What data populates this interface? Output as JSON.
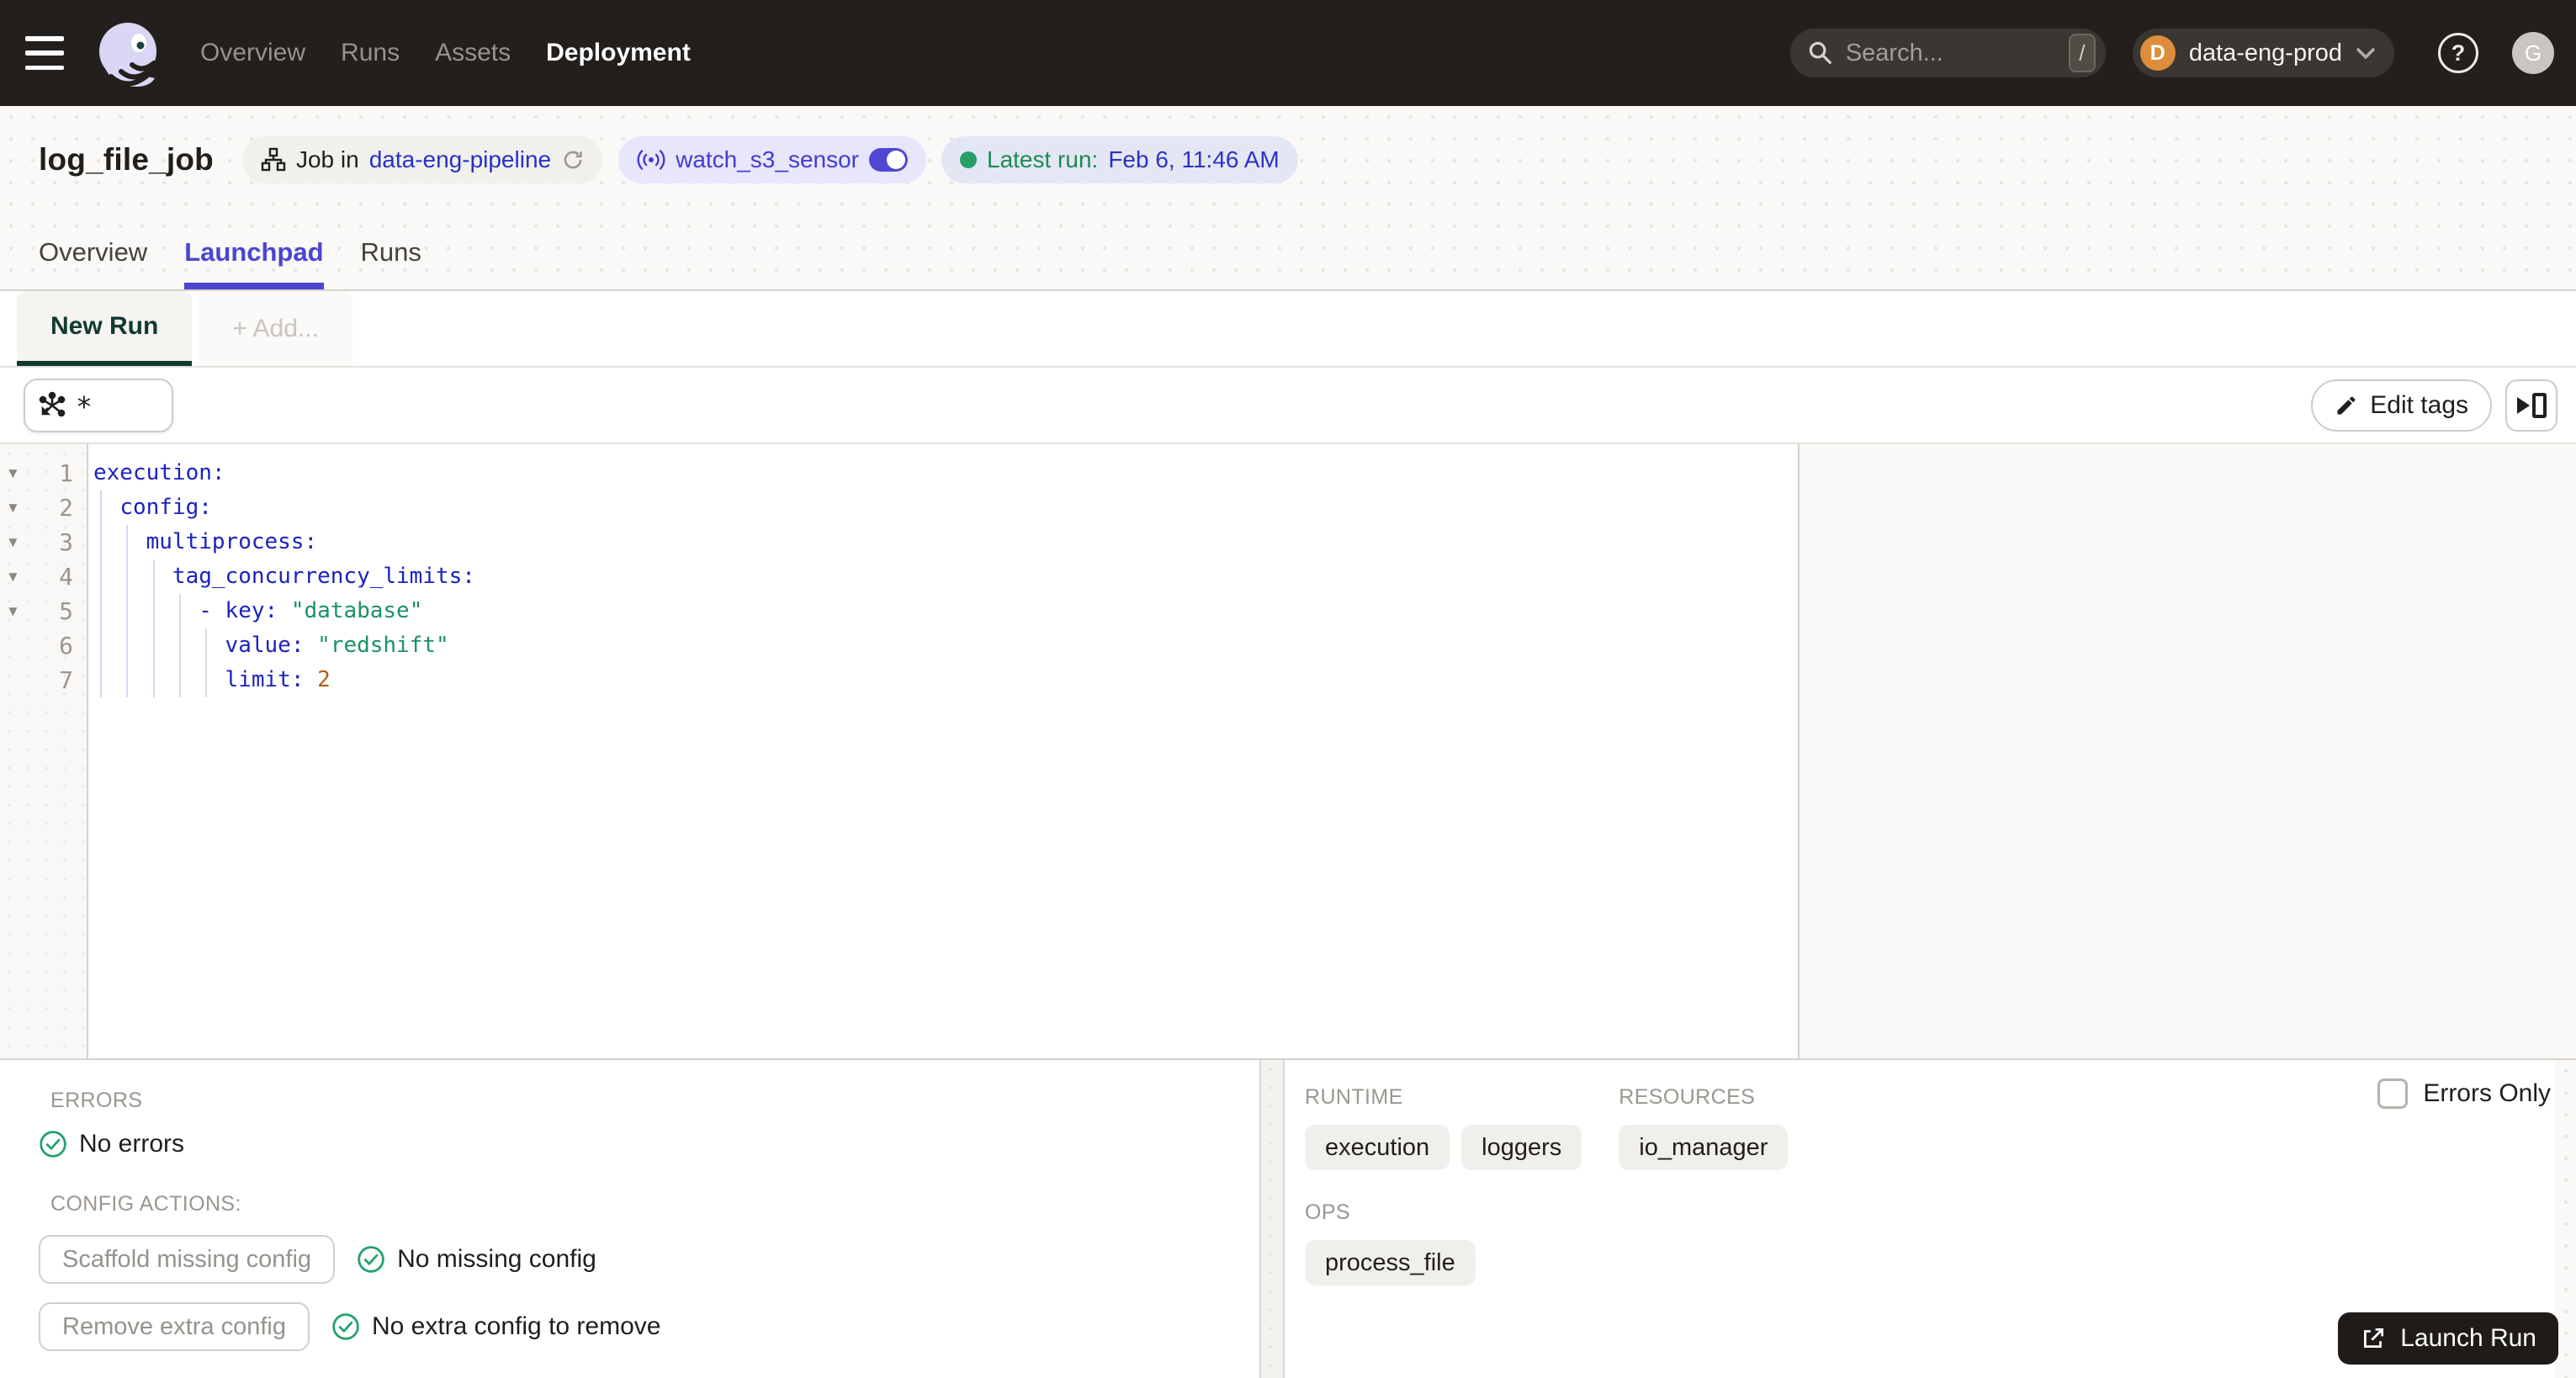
{
  "nav": {
    "items": [
      {
        "label": "Overview",
        "active": false
      },
      {
        "label": "Runs",
        "active": false
      },
      {
        "label": "Assets",
        "active": false
      },
      {
        "label": "Deployment",
        "active": true
      }
    ],
    "search_placeholder": "Search...",
    "search_shortcut": "/",
    "env": {
      "initial": "D",
      "name": "data-eng-prod"
    },
    "user_initial": "G"
  },
  "header": {
    "title": "log_file_job",
    "job_pill": {
      "prefix": "Job in",
      "link": "data-eng-pipeline"
    },
    "sensor_pill": {
      "name": "watch_s3_sensor",
      "enabled": true
    },
    "latest_run": {
      "label": "Latest run:",
      "value": "Feb 6, 11:46 AM"
    }
  },
  "tabs": [
    {
      "label": "Overview",
      "active": false
    },
    {
      "label": "Launchpad",
      "active": true
    },
    {
      "label": "Runs",
      "active": false
    }
  ],
  "run_tabs": {
    "new_run": "New Run",
    "add": "+ Add..."
  },
  "toolbar": {
    "op_selector_value": "*",
    "edit_tags": "Edit tags"
  },
  "editor": {
    "lines": [
      {
        "num": 1,
        "fold": true,
        "tokens": [
          {
            "c": "k",
            "t": "execution"
          },
          {
            "c": "k",
            "t": ":"
          }
        ]
      },
      {
        "num": 2,
        "fold": true,
        "tokens": [
          {
            "c": "w",
            "t": "  "
          },
          {
            "c": "k",
            "t": "config"
          },
          {
            "c": "k",
            "t": ":"
          }
        ]
      },
      {
        "num": 3,
        "fold": true,
        "tokens": [
          {
            "c": "w",
            "t": "    "
          },
          {
            "c": "k",
            "t": "multiprocess"
          },
          {
            "c": "k",
            "t": ":"
          }
        ]
      },
      {
        "num": 4,
        "fold": true,
        "tokens": [
          {
            "c": "w",
            "t": "      "
          },
          {
            "c": "k",
            "t": "tag_concurrency_limits"
          },
          {
            "c": "k",
            "t": ":"
          }
        ]
      },
      {
        "num": 5,
        "fold": true,
        "tokens": [
          {
            "c": "w",
            "t": "        "
          },
          {
            "c": "k",
            "t": "- "
          },
          {
            "c": "k",
            "t": "key"
          },
          {
            "c": "k",
            "t": ": "
          },
          {
            "c": "s",
            "t": "\"database\""
          }
        ]
      },
      {
        "num": 6,
        "fold": false,
        "tokens": [
          {
            "c": "w",
            "t": "          "
          },
          {
            "c": "k",
            "t": "value"
          },
          {
            "c": "k",
            "t": ": "
          },
          {
            "c": "s",
            "t": "\"redshift\""
          }
        ]
      },
      {
        "num": 7,
        "fold": false,
        "tokens": [
          {
            "c": "w",
            "t": "          "
          },
          {
            "c": "k",
            "t": "limit"
          },
          {
            "c": "k",
            "t": ": "
          },
          {
            "c": "n",
            "t": "2"
          }
        ]
      }
    ]
  },
  "panel": {
    "errors_label": "ERRORS",
    "no_errors": "No errors",
    "config_actions_label": "CONFIG ACTIONS:",
    "actions": [
      {
        "button": "Scaffold missing config",
        "status": "No missing config"
      },
      {
        "button": "Remove extra config",
        "status": "No extra config to remove"
      }
    ],
    "runtime_label": "RUNTIME",
    "runtime_tags": [
      "execution",
      "loggers"
    ],
    "resources_label": "RESOURCES",
    "resources_tags": [
      "io_manager"
    ],
    "ops_label": "OPS",
    "ops_tags": [
      "process_file"
    ],
    "errors_only": "Errors Only",
    "launch_run": "Launch Run"
  },
  "colors": {
    "nav_bg": "#231f1c",
    "accent_indigo": "#4b45d2",
    "env_orange": "#de8d3a",
    "success_green": "#23a26c",
    "new_run_teal": "#113a31",
    "yaml_key": "#1b22bf",
    "yaml_string": "#1c9163",
    "yaml_number": "#b25d12",
    "pill_lavender": "#e7e6fb",
    "pill_blue_gray": "#e3e7f3"
  }
}
